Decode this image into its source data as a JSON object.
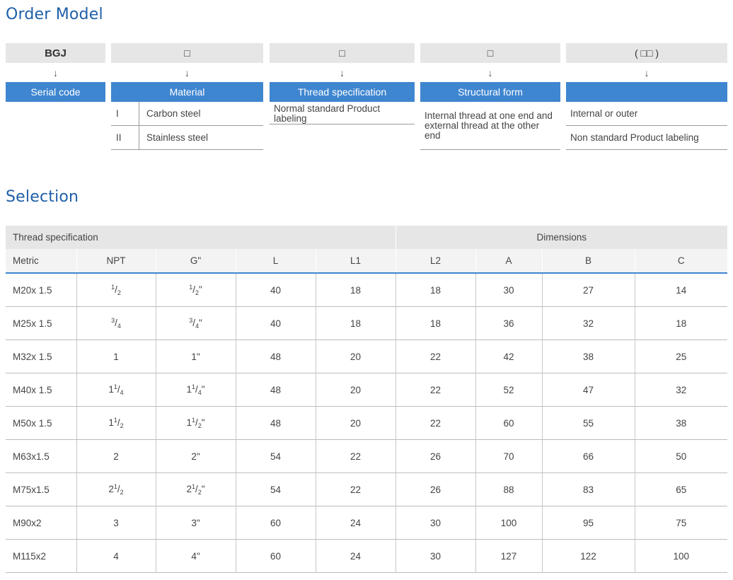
{
  "order": {
    "title": "Order Model",
    "columns": [
      {
        "code": "BGJ",
        "arrow": "↓",
        "header": "Serial code"
      },
      {
        "code": "□",
        "arrow": "↓",
        "header": "Material"
      },
      {
        "code": "□",
        "arrow": "↓",
        "header": "Thread specification"
      },
      {
        "code": "□",
        "arrow": "↓",
        "header": "Structural form"
      },
      {
        "code": "( □□ )",
        "arrow": "↓",
        "header": ""
      }
    ],
    "materials": [
      {
        "num": "I",
        "name": "Carbon steel"
      },
      {
        "num": "II",
        "name": "Stainless steel"
      }
    ],
    "thread_note": "Normal standard Product labeling",
    "structural_note": "Internal thread at one end and external thread at the other end",
    "options": [
      "Internal or outer",
      "Non standard Product labeling"
    ]
  },
  "selection": {
    "title": "Selection",
    "group_thread": "Thread specification",
    "group_dimensions": "Dimensions",
    "headers": [
      "Metric",
      "NPT",
      "G\"",
      "L",
      "L1",
      "L2",
      "A",
      "B",
      "C"
    ],
    "rows": [
      {
        "metric": "M20x 1.5",
        "npt": {
          "w": "",
          "n": "1",
          "d": "2"
        },
        "g": {
          "w": "",
          "n": "1",
          "d": "2"
        },
        "L": "40",
        "L1": "18",
        "L2": "18",
        "A": "30",
        "B": "27",
        "C": "14"
      },
      {
        "metric": "M25x 1.5",
        "npt": {
          "w": "",
          "n": "3",
          "d": "4"
        },
        "g": {
          "w": "",
          "n": "3",
          "d": "4"
        },
        "L": "40",
        "L1": "18",
        "L2": "18",
        "A": "36",
        "B": "32",
        "C": "18"
      },
      {
        "metric": "M32x 1.5",
        "npt": {
          "w": "1",
          "n": "",
          "d": ""
        },
        "g": {
          "w": "1",
          "n": "",
          "d": ""
        },
        "L": "48",
        "L1": "20",
        "L2": "22",
        "A": "42",
        "B": "38",
        "C": "25"
      },
      {
        "metric": "M40x 1.5",
        "npt": {
          "w": "1",
          "n": "1",
          "d": "4"
        },
        "g": {
          "w": "1",
          "n": "1",
          "d": "4"
        },
        "L": "48",
        "L1": "20",
        "L2": "22",
        "A": "52",
        "B": "47",
        "C": "32"
      },
      {
        "metric": "M50x 1.5",
        "npt": {
          "w": "1",
          "n": "1",
          "d": "2"
        },
        "g": {
          "w": "1",
          "n": "1",
          "d": "2"
        },
        "L": "48",
        "L1": "20",
        "L2": "22",
        "A": "60",
        "B": "55",
        "C": "38"
      },
      {
        "metric": "M63x1.5",
        "npt": {
          "w": "2",
          "n": "",
          "d": ""
        },
        "g": {
          "w": "2",
          "n": "",
          "d": ""
        },
        "L": "54",
        "L1": "22",
        "L2": "26",
        "A": "70",
        "B": "66",
        "C": "50"
      },
      {
        "metric": "M75x1.5",
        "npt": {
          "w": "2",
          "n": "1",
          "d": "2"
        },
        "g": {
          "w": "2",
          "n": "1",
          "d": "2"
        },
        "L": "54",
        "L1": "22",
        "L2": "26",
        "A": "88",
        "B": "83",
        "C": "65"
      },
      {
        "metric": "M90x2",
        "npt": {
          "w": "3",
          "n": "",
          "d": ""
        },
        "g": {
          "w": "3",
          "n": "",
          "d": ""
        },
        "L": "60",
        "L1": "24",
        "L2": "30",
        "A": "100",
        "B": "95",
        "C": "75"
      },
      {
        "metric": "M115x2",
        "npt": {
          "w": "4",
          "n": "",
          "d": ""
        },
        "g": {
          "w": "4",
          "n": "",
          "d": ""
        },
        "L": "60",
        "L1": "24",
        "L2": "30",
        "A": "127",
        "B": "122",
        "C": "100"
      }
    ]
  },
  "colors": {
    "accent": "#3f86d0",
    "heading": "#1f5fa8",
    "code_bg": "#e6e6e6"
  }
}
